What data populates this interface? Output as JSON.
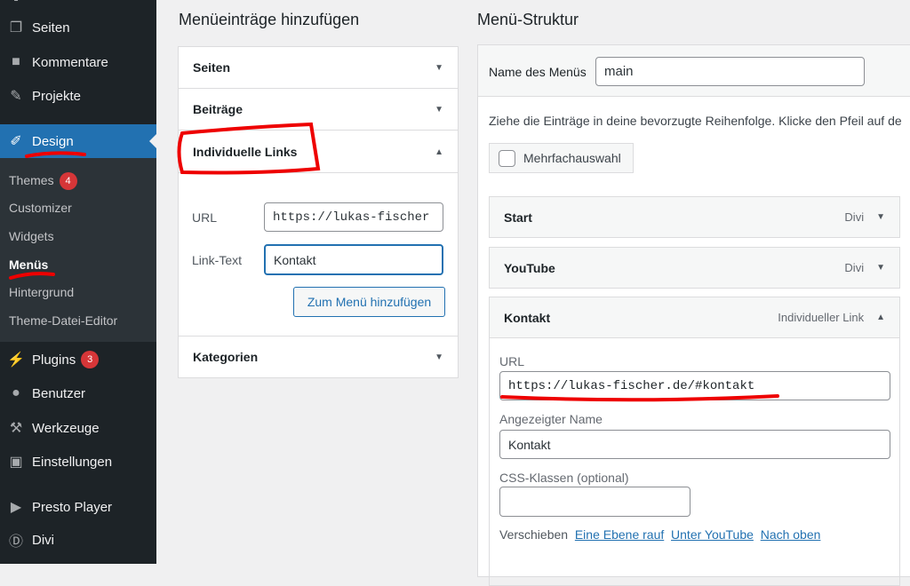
{
  "sidebar": {
    "items": [
      {
        "label": "Seiten",
        "icon": "pages-icon"
      },
      {
        "label": "Kommentare",
        "icon": "comment-icon"
      },
      {
        "label": "Projekte",
        "icon": "pin-icon"
      },
      {
        "label": "Design",
        "icon": "brush-icon",
        "active": true
      },
      {
        "label": "Plugins",
        "icon": "plugin-icon",
        "badge": "3"
      },
      {
        "label": "Benutzer",
        "icon": "user-icon"
      },
      {
        "label": "Werkzeuge",
        "icon": "wrench-icon"
      },
      {
        "label": "Einstellungen",
        "icon": "settings-icon"
      },
      {
        "label": "Presto Player",
        "icon": "play-icon"
      },
      {
        "label": "Divi",
        "icon": "divi-icon"
      }
    ],
    "submenu": [
      {
        "label": "Themes",
        "badge": "4"
      },
      {
        "label": "Customizer"
      },
      {
        "label": "Widgets"
      },
      {
        "label": "Menüs",
        "current": true
      },
      {
        "label": "Hintergrund"
      },
      {
        "label": "Theme-Datei-Editor"
      }
    ]
  },
  "add": {
    "title": "Menüeinträge hinzufügen",
    "sections": [
      "Seiten",
      "Beiträge",
      "Individuelle Links",
      "Kategorien"
    ],
    "url_label": "URL",
    "url_value": "https://lukas-fischer",
    "linktext_label": "Link-Text",
    "linktext_value": "Kontakt",
    "add_button": "Zum Menü hinzufügen"
  },
  "structure": {
    "title": "Menü-Struktur",
    "name_label": "Name des Menüs",
    "name_value": "main",
    "instructions": "Ziehe die Einträge in deine bevorzugte Reihenfolge. Klicke den Pfeil auf de",
    "bulk_label": "Mehrfachauswahl",
    "items": [
      {
        "title": "Start",
        "type": "Divi"
      },
      {
        "title": "YouTube",
        "type": "Divi"
      },
      {
        "title": "Kontakt",
        "type": "Individueller Link"
      }
    ],
    "edit": {
      "url_label": "URL",
      "url_value": "https://lukas-fischer.de/#kontakt",
      "name_label": "Angezeigter Name",
      "name_value": "Kontakt",
      "css_label": "CSS-Klassen (optional)",
      "css_value": "",
      "move_label": "Verschieben",
      "move_links": [
        "Eine Ebene rauf",
        "Unter YouTube",
        "Nach oben"
      ]
    }
  },
  "colors": {
    "sidebar": "#1d2327",
    "active": "#2271b1",
    "annotation": "#e00000"
  }
}
